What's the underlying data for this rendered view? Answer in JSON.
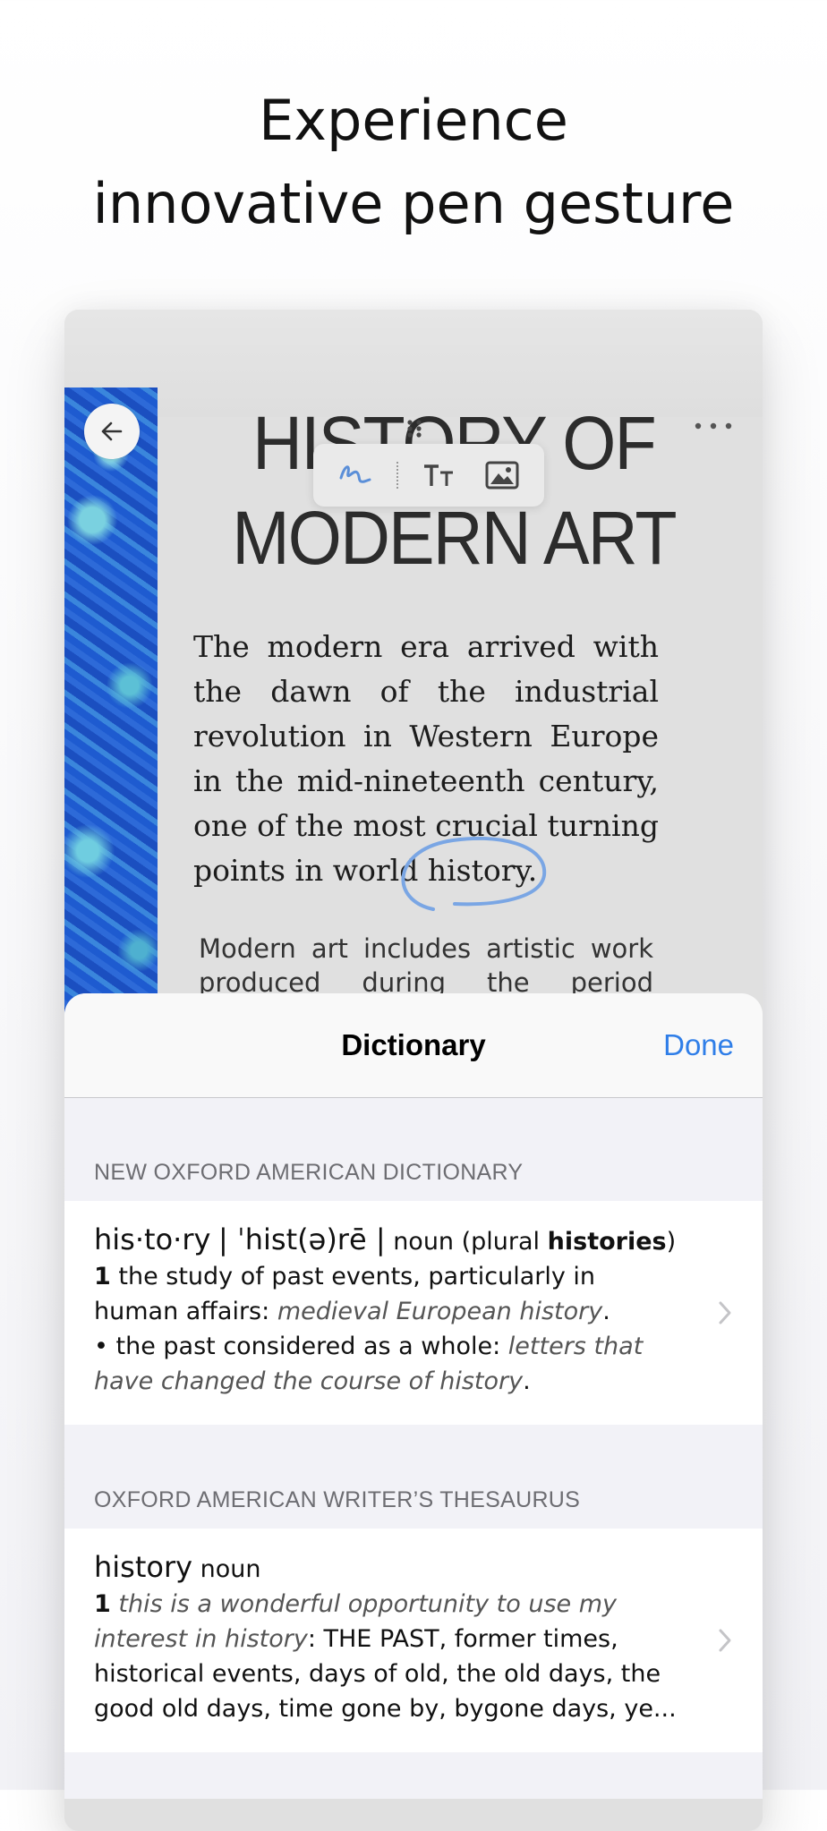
{
  "headline": {
    "line1": "Experience",
    "line2": "innovative pen gesture"
  },
  "reader": {
    "title_line1": "HISTORY OF",
    "title_line2": "MODERN ART",
    "paragraph_lines": [
      "The modern era arrived with",
      "the dawn of the industrial",
      "revolution in Western Europe",
      "in the mid-nineteenth century,",
      "one of the most crucial turning",
      "points in world history."
    ],
    "second_paragraph_lines": [
      "Modern art includes artistic work",
      "produced during the period"
    ],
    "back_icon": "arrow-left-icon",
    "more_icon": "ellipsis-icon",
    "pen_tools": [
      "pen-scribble-icon",
      "text-size-icon",
      "image-icon"
    ]
  },
  "dictionary": {
    "title": "Dictionary",
    "done_label": "Done",
    "sections": [
      {
        "label": "NEW OXFORD AMERICAN DICTIONARY",
        "headword": "his·to·ry",
        "pronunciation": "| ˈhist(ə)rē |",
        "pos": "noun (plural ",
        "plural": "histories",
        "pos_close": ")",
        "sense1_num": "1",
        "sense1_text": " the study of past events, particularly in human affairs: ",
        "sense1_example": "medieval European history",
        "sense1_end": ".",
        "sense2_text": "• the past considered as a whole: ",
        "sense2_example": "letters that have changed the course of history",
        "sense2_end": "."
      },
      {
        "label": "OXFORD AMERICAN WRITER’S THESAURUS",
        "headword": "history",
        "pos": "noun",
        "sense1_num": "1",
        "sense1_example": "this is a wonderful opportunity to use my interest in history",
        "sense1_text": ": THE PAST, former times, historical events, days of old, the old days, the good old days, time gone by, bygone days, ye..."
      }
    ]
  },
  "colors": {
    "accent": "#2f7ee8",
    "pen_stroke": "#7aa6e4",
    "cover_blue": "#1e5bd0"
  }
}
